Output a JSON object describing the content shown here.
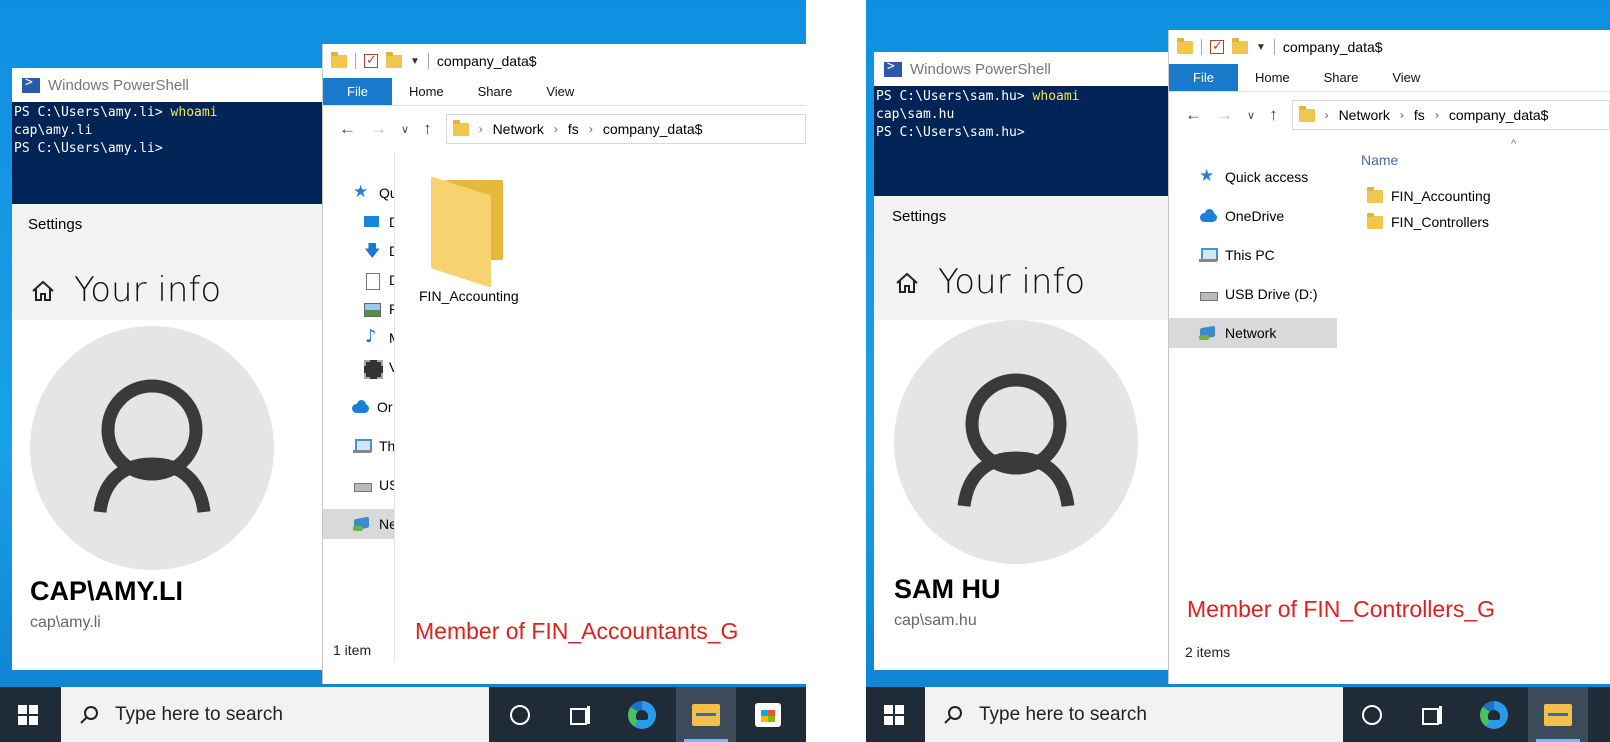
{
  "left": {
    "powershell": {
      "title": "Windows PowerShell",
      "lines": [
        {
          "prompt": "PS C:\\Users\\amy.li> ",
          "cmd": "whoami"
        },
        {
          "prompt": "cap\\amy.li",
          "cmd": ""
        },
        {
          "prompt": "PS C:\\Users\\amy.li>",
          "cmd": ""
        }
      ]
    },
    "settings": {
      "label": "Settings",
      "title": "Your info",
      "display_name": "CAP\\AMY.LI",
      "account": "cap\\amy.li"
    },
    "explorer": {
      "qat_title": "company_data$",
      "ribbon_tabs": [
        "File",
        "Home",
        "Share",
        "View"
      ],
      "address": [
        "Network",
        "fs",
        "company_data$"
      ],
      "nav_items": [
        "Qu",
        "D",
        "D",
        "D",
        "P",
        "M",
        "V",
        "Or",
        "Th",
        "US",
        "Ne"
      ],
      "folder": "FIN_Accounting",
      "status": "1 item"
    },
    "annotation": "Member of FIN_Accountants_G",
    "taskbar": {
      "search_placeholder": "Type here to search"
    }
  },
  "right": {
    "powershell": {
      "title": "Windows PowerShell",
      "lines": [
        {
          "prompt": "PS C:\\Users\\sam.hu> ",
          "cmd": "whoami"
        },
        {
          "prompt": "cap\\sam.hu",
          "cmd": ""
        },
        {
          "prompt": "PS C:\\Users\\sam.hu>",
          "cmd": ""
        }
      ]
    },
    "settings": {
      "label": "Settings",
      "title": "Your info",
      "display_name": "SAM HU",
      "account": "cap\\sam.hu"
    },
    "explorer": {
      "qat_title": "company_data$",
      "ribbon_tabs": [
        "File",
        "Home",
        "Share",
        "View"
      ],
      "address": [
        "Network",
        "fs",
        "company_data$"
      ],
      "nav_items": [
        "Quick access",
        "OneDrive",
        "This PC",
        "USB Drive (D:)",
        "Network"
      ],
      "column_header": "Name",
      "files": [
        "FIN_Accounting",
        "FIN_Controllers"
      ],
      "status": "2 items"
    },
    "annotation": "Member of FIN_Controllers_G",
    "taskbar": {
      "search_placeholder": "Type here to search"
    }
  }
}
